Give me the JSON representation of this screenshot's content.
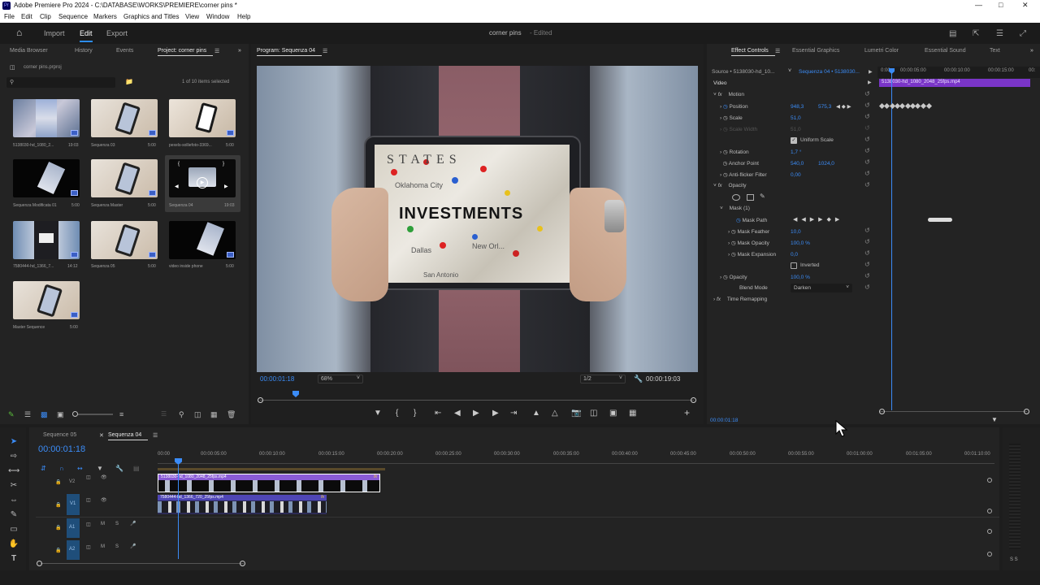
{
  "titlebar": {
    "title": "Adobe Premiere Pro 2024 - C:\\DATABASE\\WORKS\\PREMIERE\\corner pins *",
    "logo": "Pr"
  },
  "menu": [
    "File",
    "Edit",
    "Clip",
    "Sequence",
    "Markers",
    "Graphics and Titles",
    "View",
    "Window",
    "Help"
  ],
  "workspace": {
    "import": "Import",
    "edit": "Edit",
    "export": "Export",
    "project_name": "corner pins",
    "edited": "- Edited"
  },
  "project_panel": {
    "tabs": [
      "Media Browser",
      "History",
      "Events",
      "Project: corner pins"
    ],
    "file": "corner pins.prproj",
    "selection": "1 of 10 items selected",
    "items": [
      {
        "name": "5138030-hd_1080_2...",
        "dur": "19:03"
      },
      {
        "name": "Sequenza 03",
        "dur": "5:00"
      },
      {
        "name": "pexels-solliefoto-3369...",
        "dur": "5:00"
      },
      {
        "name": "Sequenza Modificata 01",
        "dur": "5:00"
      },
      {
        "name": "Sequenza Master",
        "dur": "5:00"
      },
      {
        "name": "Sequenza 04",
        "dur": "19:03"
      },
      {
        "name": "7580444-hd_1366_7...",
        "dur": "14:12"
      },
      {
        "name": "Sequenza 05",
        "dur": "5:00"
      },
      {
        "name": "video inside phone",
        "dur": "5:00"
      },
      {
        "name": "Master Sequence",
        "dur": "5:00"
      }
    ]
  },
  "program": {
    "title": "Program: Sequenza 04",
    "timecode": "00:00:01:18",
    "zoom": "68%",
    "quality": "1/2",
    "duration": "00:00:19:03",
    "overlay_text": "INVESTMENTS",
    "map_words": [
      "STATES",
      "Oklahoma City",
      "Dallas",
      "San Antonio",
      "New Orl..."
    ]
  },
  "effect_controls": {
    "tabs": [
      "Effect Controls",
      "Essential Graphics",
      "Lumetri Color",
      "Essential Sound",
      "Text"
    ],
    "source": "Source • 5138030-hd_10...",
    "sequence": "Sequenza 04 • 5138030...",
    "ruler": [
      "0:00",
      "00:00:05:00",
      "00:00:10:00",
      "00:00:15:00",
      "00:"
    ],
    "clip_bar": "5138030-hd_1080_2048_25fps.mp4",
    "section": "Video",
    "motion": "Motion",
    "position_label": "Position",
    "position_x": "948,3",
    "position_y": "575,3",
    "scale_label": "Scale",
    "scale_val": "51,0",
    "scale_width_label": "Scale Width",
    "scale_width_val": "51,0",
    "uniform_label": "Uniform Scale",
    "rotation_label": "Rotation",
    "rotation_val": "1,7 °",
    "anchor_label": "Anchor Point",
    "anchor_x": "540,0",
    "anchor_y": "1024,0",
    "flicker_label": "Anti-flicker Filter",
    "flicker_val": "0,00",
    "opacity_section": "Opacity",
    "mask_label": "Mask (1)",
    "mask_path": "Mask Path",
    "mask_feather_label": "Mask Feather",
    "mask_feather_val": "10,0",
    "mask_opacity_label": "Mask Opacity",
    "mask_opacity_val": "100,0 %",
    "mask_expansion_label": "Mask Expansion",
    "mask_expansion_val": "0,0",
    "inverted_label": "Inverted",
    "opacity_label": "Opacity",
    "opacity_val": "100,0 %",
    "blend_label": "Blend Mode",
    "blend_val": "Darken",
    "time_remap": "Time Remapping",
    "footer_time": "00:00:01:18"
  },
  "timeline": {
    "tabs": [
      "Sequence 05",
      "Sequenza 04"
    ],
    "timecode": "00:00:01:18",
    "ruler": [
      "00:00",
      "00:00:05:00",
      "00:00:10:00",
      "00:00:15:00",
      "00:00:20:00",
      "00:00:25:00",
      "00:00:30:00",
      "00:00:35:00",
      "00:00:40:00",
      "00:00:45:00",
      "00:00:50:00",
      "00:00:55:00",
      "00:01:00:00",
      "00:01:05:00",
      "00:01:10:00"
    ],
    "tracks": [
      "V2",
      "V1",
      "A1",
      "A2"
    ],
    "clip_v2": "5138030-hd_1080_2048_25fps.mp4",
    "clip_v1": "7580444-hd_1366_720_25fps.mp4",
    "fx": "fx",
    "meter_label": "S S"
  },
  "colors": {
    "accent": "#2d8ceb",
    "clip_purple": "#8a5bd6",
    "clip_v1": "#6a5acd",
    "panel": "#232323",
    "bg": "#1d1d1d"
  }
}
